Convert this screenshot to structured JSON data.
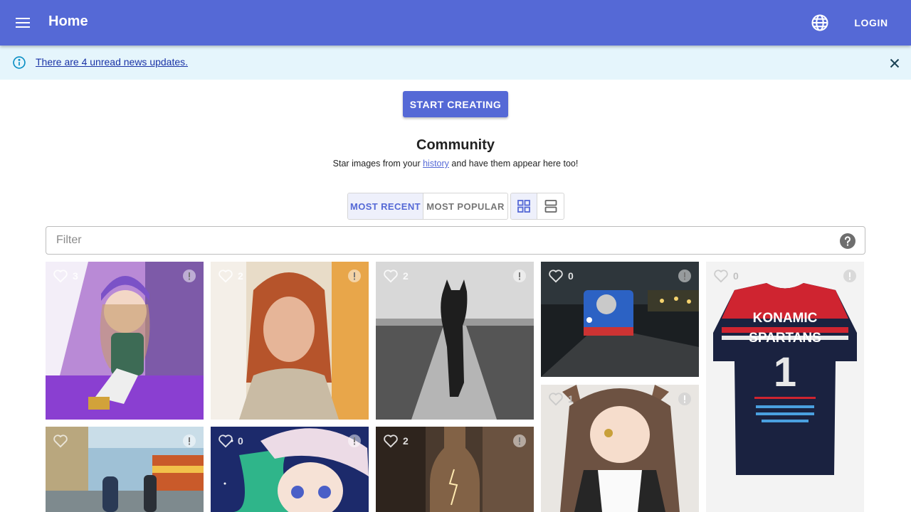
{
  "appbar": {
    "title": "Home",
    "login_label": "LOGIN"
  },
  "banner": {
    "text": "There are 4 unread news updates."
  },
  "actions": {
    "start_label": "START CREATING"
  },
  "community": {
    "title": "Community",
    "subtitle_before": "Star images from your ",
    "subtitle_link": "history",
    "subtitle_after": " and have them appear here too!"
  },
  "sort": {
    "recent_label": "MOST RECENT",
    "popular_label": "MOST POPULAR"
  },
  "filter": {
    "placeholder": "Filter"
  },
  "gallery": [
    {
      "likes": "3",
      "subject": "anime girl purple beret sitting",
      "palette": "#8a3fd1"
    },
    {
      "likes": "2",
      "subject": "red-haired woman portrait",
      "palette": "#c89a6a"
    },
    {
      "likes": "2",
      "subject": "black dog on dirt road",
      "palette": "#6b6b6b"
    },
    {
      "likes": "0",
      "subject": "blue train engine at night",
      "palette": "#2b3236"
    },
    {
      "likes": "0",
      "subject": "Konamic Spartans jersey",
      "palette": "#f2f2f2"
    },
    {
      "likes": "1",
      "subject": "anime wolf girl maid",
      "palette": "#e9e6e2"
    },
    {
      "likes": "",
      "subject": "train station platform",
      "palette": "#8fa8b8"
    },
    {
      "likes": "0",
      "subject": "green-haired anime girl knit hat",
      "palette": "#1c2a6b"
    },
    {
      "likes": "2",
      "subject": "bottle with lightning",
      "palette": "#4a3a2e"
    }
  ]
}
